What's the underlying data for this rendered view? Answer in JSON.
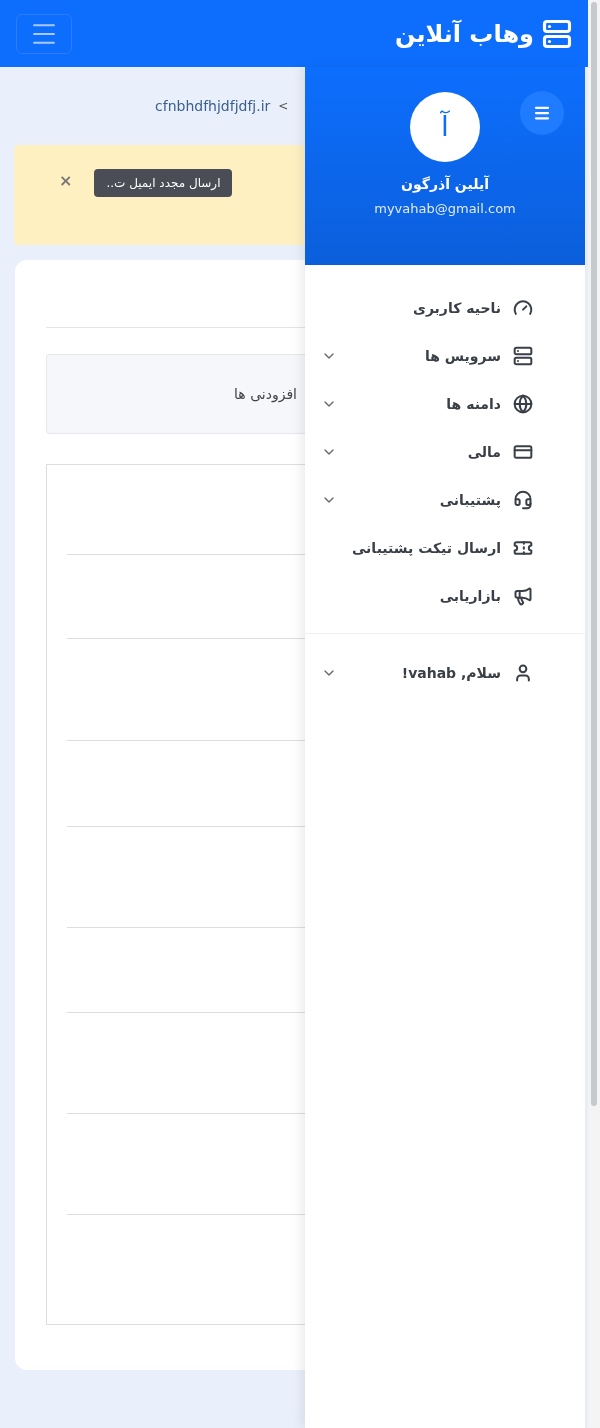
{
  "header": {
    "brand": "وهاب آنلاین"
  },
  "breadcrumb": {
    "separator": "<",
    "current": "cfnbhdfhjdfjdfj.ir"
  },
  "alert": {
    "button": "ارسال مجدد ایمیل ت..",
    "close": "×"
  },
  "addons_tab": {
    "label": "افزودنی ها"
  },
  "sidebar": {
    "avatar_letter": "آ",
    "name": "آیلین آذرگون",
    "email": "myvahab@gmail.com",
    "items": [
      {
        "label": "ناحیه کاربری",
        "expandable": false
      },
      {
        "label": "سرویس ها",
        "expandable": true
      },
      {
        "label": "دامنه ها",
        "expandable": true
      },
      {
        "label": "مالی",
        "expandable": true
      },
      {
        "label": "پشتیبانی",
        "expandable": true
      },
      {
        "label": "ارسال تیکت پشتیبانی",
        "expandable": false
      },
      {
        "label": "بازاریابی",
        "expandable": false
      }
    ],
    "user": {
      "label": "سلام, vahab!",
      "expandable": true
    }
  }
}
